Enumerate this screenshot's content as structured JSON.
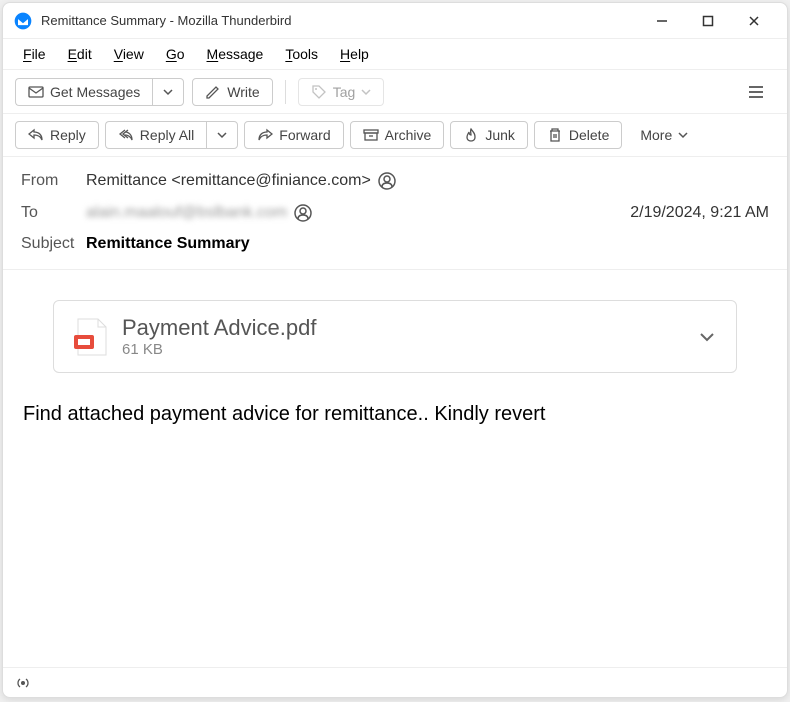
{
  "window": {
    "title": "Remittance Summary - Mozilla Thunderbird"
  },
  "menubar": {
    "file": "File",
    "edit": "Edit",
    "view": "View",
    "go": "Go",
    "message": "Message",
    "tools": "Tools",
    "help": "Help"
  },
  "toolbar1": {
    "get_messages": "Get Messages",
    "write": "Write",
    "tag": "Tag"
  },
  "toolbar2": {
    "reply": "Reply",
    "reply_all": "Reply All",
    "forward": "Forward",
    "archive": "Archive",
    "junk": "Junk",
    "delete": "Delete",
    "more": "More"
  },
  "header": {
    "from_label": "From",
    "from_value": "Remittance <remittance@finiance.com>",
    "to_label": "To",
    "to_value": "alain.maalouf@bslbank.com",
    "date": "2/19/2024, 9:21 AM",
    "subject_label": "Subject",
    "subject_value": "Remittance Summary"
  },
  "attachment": {
    "name": "Payment Advice.pdf",
    "size": "61 KB"
  },
  "body": {
    "text": "Find attached payment advice for remittance.. Kindly revert"
  }
}
